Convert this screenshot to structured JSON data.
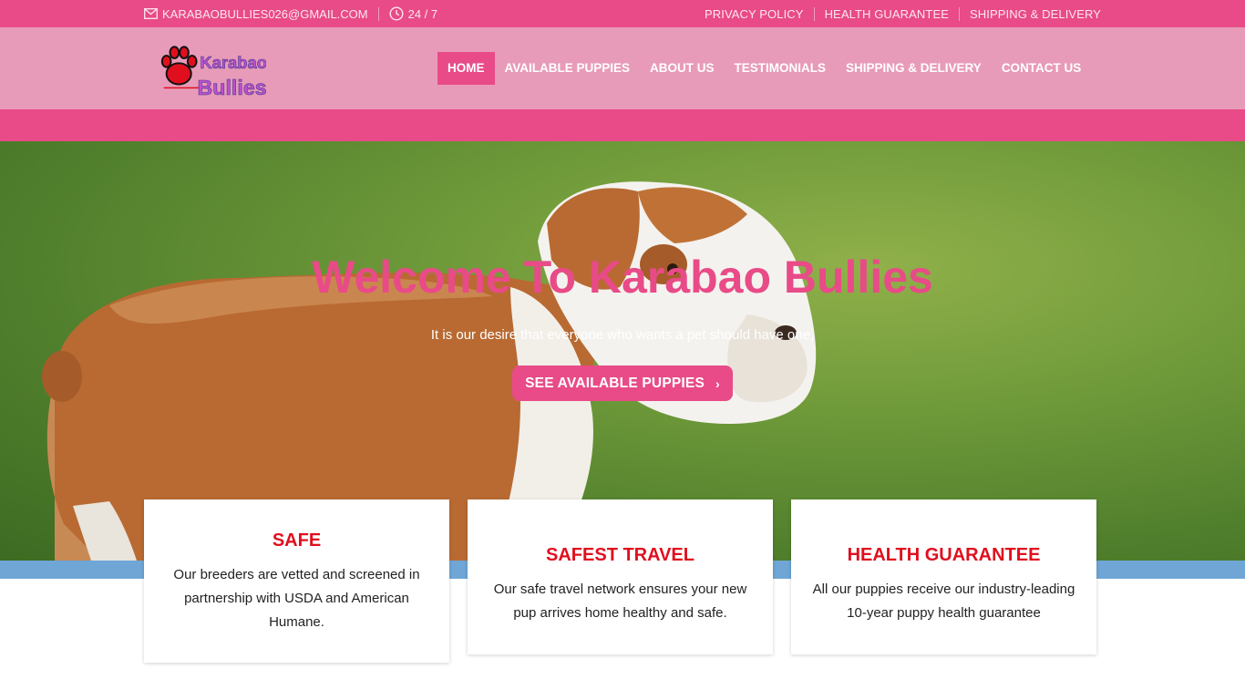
{
  "topbar": {
    "email": "KARABAOBULLIES026@GMAIL.COM",
    "hours": "24 / 7",
    "links": [
      "PRIVACY POLICY",
      "HEALTH GUARANTEE",
      "SHIPPING & DELIVERY"
    ]
  },
  "logo": {
    "line1": "Karabao",
    "line2": "Bullies"
  },
  "nav": {
    "items": [
      "HOME",
      "AVAILABLE PUPPIES",
      "ABOUT US",
      "TESTIMONIALS",
      "SHIPPING & DELIVERY",
      "CONTACT US"
    ],
    "active": "HOME"
  },
  "hero": {
    "title": "Welcome To Karabao Bullies",
    "subtitle": "It is our desire that everyone who wants a pet should have one,",
    "button": "SEE AVAILABLE PUPPIES"
  },
  "features": [
    {
      "title": "SAFE",
      "text": "Our breeders are vetted and screened in partnership with USDA and American Humane."
    },
    {
      "title": "SAFEST TRAVEL",
      "text": "Our safe travel network ensures your new pup arrives home healthy and safe."
    },
    {
      "title": "HEALTH GUARANTEE",
      "text": "All our puppies receive our industry-leading 10-year puppy health guarantee"
    }
  ],
  "colors": {
    "brand_pink": "#e84b87",
    "header_pink": "#e89bb8",
    "feature_title_red": "#e00f1e",
    "accent_blue": "#6fa6d6"
  },
  "icons": {
    "email": "envelope-icon",
    "hours": "clock-icon",
    "button": "chevron-right-icon",
    "logo": "paw-icon"
  }
}
